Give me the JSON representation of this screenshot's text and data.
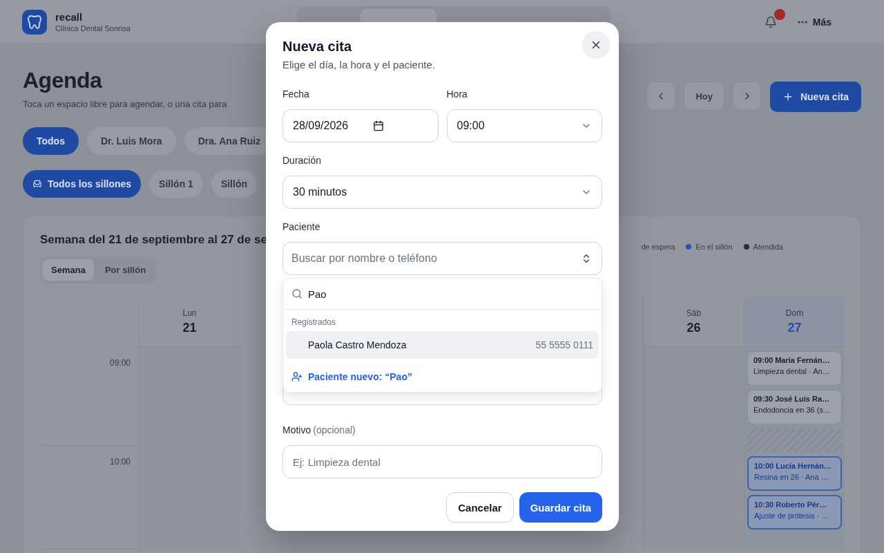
{
  "app": {
    "name": "recall",
    "clinic": "Clínica Dental Sonrisa"
  },
  "header_actions": {
    "more": "Más"
  },
  "page": {
    "title": "Agenda",
    "subtitle": "Toca un espacio libre para agendar, o una cita para",
    "toolbar": {
      "today": "Hoy",
      "new": "Nueva cita"
    },
    "dentists": [
      {
        "label": "Todos",
        "selected": true
      },
      {
        "label": "Dr. Luis Mora",
        "selected": false
      },
      {
        "label": "Dra. Ana Ruiz",
        "selected": false
      }
    ],
    "chairs": [
      {
        "label": "Todos los sillones",
        "selected": true
      },
      {
        "label": "Sillón 1",
        "selected": false
      },
      {
        "label": "Sillón",
        "selected": false
      }
    ]
  },
  "calendar": {
    "title": "Semana del 21 de septiembre al 27 de se",
    "views": [
      {
        "label": "Semana",
        "selected": true
      },
      {
        "label": "Por sillón",
        "selected": false
      }
    ],
    "legend": [
      {
        "label": "de espera"
      },
      {
        "label": "En el sillón",
        "color": "#2553b3"
      },
      {
        "label": "Atendida",
        "color": "#2b3038"
      }
    ],
    "hours": [
      "09:00",
      "10:00"
    ],
    "days": [
      {
        "weekday": "Lun",
        "date": "21",
        "today": false
      },
      {
        "weekday": "Sáb",
        "date": "26",
        "today": false
      },
      {
        "weekday": "Dom",
        "date": "27",
        "today": true,
        "appointments": [
          {
            "title": "09:00 María Fernán…",
            "detail": "Limpieza dental · An…",
            "kind": "scheduled"
          },
          {
            "title": "09:30 José Luis Ra…",
            "detail": "Endodoncia en 36 (s…",
            "kind": "scheduled"
          },
          {
            "kind": "blocked"
          },
          {
            "title": "10:00 Lucía Hernán…",
            "detail": "Resina en 26 · Ana …",
            "kind": "in_chair"
          },
          {
            "title": "10:30 Roberto Pér…",
            "detail": "Ajuste de prótesis · …",
            "kind": "in_chair"
          }
        ]
      }
    ]
  },
  "modal": {
    "title": "Nueva cita",
    "subtitle": "Elige el día, la hora y el paciente.",
    "date": {
      "label": "Fecha",
      "value": "28/09/2026"
    },
    "time": {
      "label": "Hora",
      "value": "09:00"
    },
    "duration": {
      "label": "Duración",
      "value": "30 minutos"
    },
    "patient": {
      "label": "Paciente",
      "placeholder": "Buscar por nombre o teléfono",
      "open": true,
      "dropdown": {
        "query": "Pao",
        "section": "Registrados",
        "options": [
          {
            "name": "Paola Castro Mendoza",
            "phone": "55 5555 0111",
            "selected": true
          }
        ],
        "create": "Paciente nuevo: “Pao”"
      }
    },
    "reason": {
      "label": "Motivo",
      "hint": "(opcional)",
      "placeholder": "Ej: Limpieza dental"
    },
    "buttons": {
      "cancel": "Cancelar",
      "save": "Guardar cita"
    }
  }
}
